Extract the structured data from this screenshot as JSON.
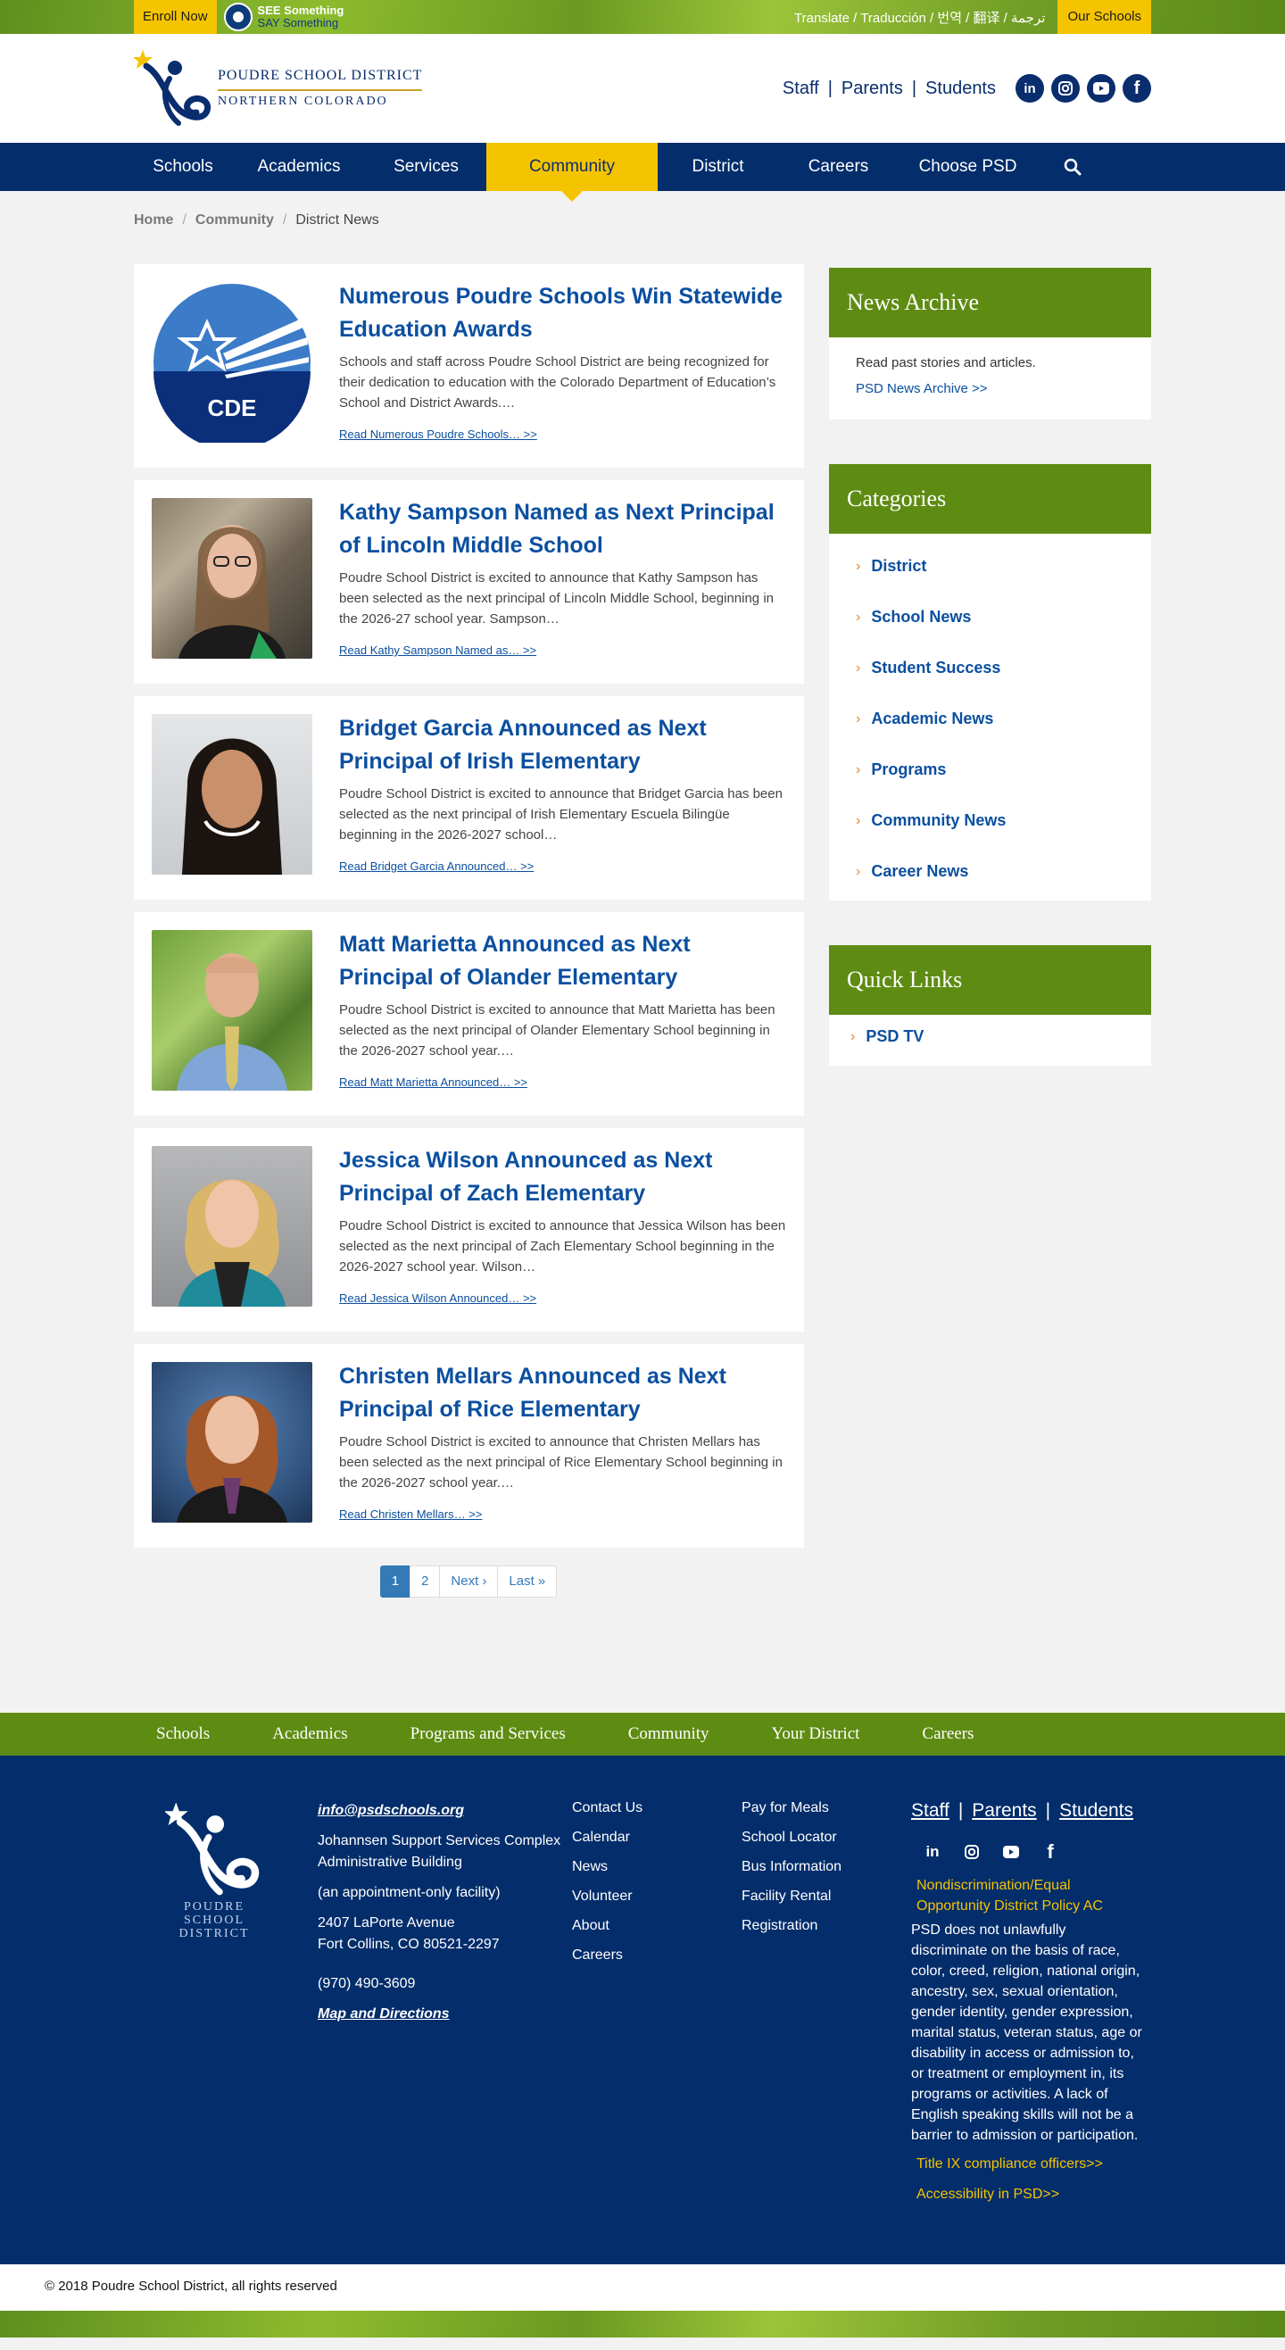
{
  "util": {
    "enroll": "Enroll Now",
    "ssss_line1": "SEE Something",
    "ssss_line2": "SAY Something",
    "translate": "Translate / Traducción / 번역 / 翻译 / ترجمة",
    "our_schools": "Our Schools"
  },
  "header": {
    "logo_line1": "POUDRE SCHOOL DISTRICT",
    "logo_line2": "NORTHERN COLORADO",
    "links": [
      "Staff",
      "Parents",
      "Students"
    ],
    "social": [
      "linkedin-icon",
      "instagram-icon",
      "youtube-icon",
      "facebook-icon"
    ]
  },
  "nav": [
    "Schools",
    "Academics",
    "Services",
    "Community",
    "District",
    "Careers",
    "Choose PSD"
  ],
  "breadcrumb": {
    "home": "Home",
    "section": "Community",
    "current": "District News"
  },
  "posts": [
    {
      "title": "Numerous Poudre Schools Win Statewide Education Awards",
      "excerpt": "Schools and staff across Poudre School District are being recognized for their dedication to education with the Colorado Department of Education’s School and District Awards.…",
      "more": "Read Numerous Poudre Schools… >>",
      "image": "cde-logo",
      "image_text": "CDE"
    },
    {
      "title": "Kathy Sampson Named as Next Principal of Lincoln Middle School",
      "excerpt": "Poudre School District is excited to announce that Kathy Sampson has been selected as the next principal of Lincoln Middle School, beginning in the 2026-27 school year. Sampson…",
      "more": "Read Kathy Sampson Named as… >>",
      "image": "portrait-photo"
    },
    {
      "title": "Bridget Garcia Announced as Next Principal of Irish Elementary",
      "excerpt": "Poudre School District is excited to announce that Bridget Garcia has been selected as the next principal of Irish Elementary Escuela Bilingüe beginning in the 2026-2027 school…",
      "more": "Read Bridget Garcia Announced… >>",
      "image": "portrait-photo"
    },
    {
      "title": "Matt Marietta Announced as Next Principal of Olander Elementary",
      "excerpt": "Poudre School District is excited to announce that Matt Marietta has been selected as the next principal of Olander Elementary School beginning in the 2026-2027 school year.…",
      "more": "Read Matt Marietta Announced… >>",
      "image": "portrait-photo"
    },
    {
      "title": "Jessica Wilson Announced as Next Principal of Zach Elementary",
      "excerpt": "Poudre School District is excited to announce that Jessica Wilson has been selected as the next principal of Zach Elementary School beginning in the 2026-2027 school year. Wilson…",
      "more": "Read Jessica Wilson Announced… >>",
      "image": "portrait-photo"
    },
    {
      "title": "Christen Mellars Announced as Next Principal of Rice Elementary",
      "excerpt": "Poudre School District is excited to announce that Christen Mellars has been selected as the next principal of Rice Elementary School beginning in the 2026-2027 school year.…",
      "more": "Read Christen Mellars… >>",
      "image": "portrait-photo"
    }
  ],
  "pager": {
    "p1": "1",
    "p2": "2",
    "next": "Next ›",
    "last": "Last »"
  },
  "sidebar": {
    "archive": {
      "title": "News Archive",
      "text": "Read past stories and articles.",
      "link": "PSD News Archive >>"
    },
    "categories": {
      "title": "Categories",
      "items": [
        "District",
        "School News",
        "Student Success",
        "Academic News",
        "Programs",
        "Community News",
        "Career News"
      ]
    },
    "quick_links": {
      "title": "Quick Links",
      "items": [
        "PSD TV"
      ]
    }
  },
  "footnav": [
    "Schools",
    "Academics",
    "Programs and Services",
    "Community",
    "Your District",
    "Careers"
  ],
  "footer": {
    "logo_name": "POUDRE SCHOOL DISTRICT",
    "email": "info@psdschools.org",
    "building": "Johannsen Support Services Complex Administrative Building",
    "appointment": "(an appointment-only facility)",
    "street": "2407 LaPorte Avenue",
    "city": "Fort Collins, CO  80521-2297",
    "phone": "(970) 490-3609",
    "map": "Map and Directions",
    "col1": [
      "Contact Us",
      "Calendar",
      "News",
      "Volunteer",
      "About",
      "Careers"
    ],
    "col2": [
      "Pay for Meals",
      "School Locator",
      "Bus Information",
      "Facility Rental",
      "Registration"
    ],
    "links": [
      "Staff",
      "Parents",
      "Students"
    ],
    "policy": "Nondiscrimination/Equal Opportunity District Policy AC",
    "notice": "PSD does not unlawfully discriminate on the basis of race, color, creed, religion, national origin, ancestry, sex, sexual orientation, gender identity, gender expression, marital status, veteran status, age or disability in access or admission to, or treatment or employment in, its programs or activities. A lack of English speaking skills will not be a barrier to admission or participation.",
    "title9": "Title IX compliance officers>>",
    "accessibility": "Accessibility in PSD>>",
    "copyright": "© 2018 Poudre School District, all rights reserved"
  },
  "colors": {
    "navy": "#032d6b",
    "green": "#5e8c13",
    "gold": "#f5c400",
    "link": "#0b4fa0"
  }
}
